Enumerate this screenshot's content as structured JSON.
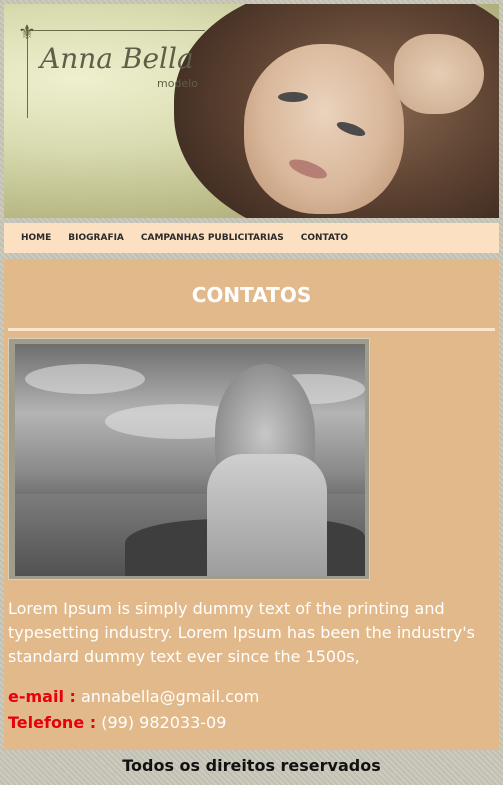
{
  "header": {
    "logo_name": "Anna Bella",
    "logo_sub": "modelo",
    "logo_icon": "fleur-de-lis-icon"
  },
  "nav": {
    "items": [
      "HOME",
      "BIOGRAFIA",
      "CAMPANHAS PUBLICITARIAS",
      "CONTATO"
    ]
  },
  "main": {
    "title": "CONTATOS",
    "body": "Lorem Ipsum is simply dummy text of the printing and typesetting industry. Lorem Ipsum has been the industry's standard dummy text ever since the 1500s,",
    "email_label": "e-mail :",
    "email_value": "annabella@gmail.com",
    "phone_label": "Telefone :",
    "phone_value": "(99) 982033-09"
  },
  "footer": {
    "text": "Todos os direitos reservados"
  },
  "colors": {
    "nav_bg": "#fbe0c2",
    "content_bg": "#e1b98b",
    "label_red": "#e8000b"
  }
}
